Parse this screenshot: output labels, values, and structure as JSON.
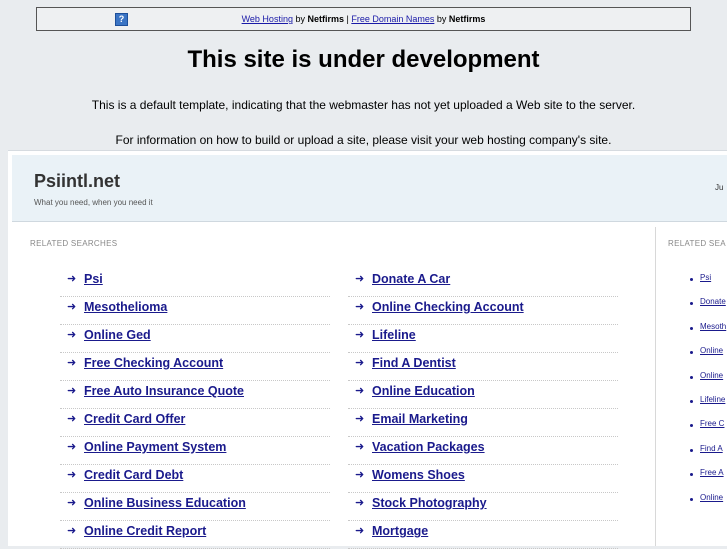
{
  "banner": {
    "link1": "Web Hosting",
    "by1": " by ",
    "brand1": "Netfirms",
    "sep": " | ",
    "link2": "Free Domain Names",
    "by2": " by ",
    "brand2": "Netfirms"
  },
  "heading": "This site is under development",
  "intro1": "This is a default template, indicating that the webmaster has not yet uploaded a Web site to the server.",
  "intro2": "For information on how to build or upload a site, please visit your web hosting company's site.",
  "site": {
    "title": "Psiintl.net",
    "tagline": "What you need, when you need it",
    "header_right": "Ju"
  },
  "related": {
    "label": "RELATED SEARCHES",
    "label_right": "RELATED SEA",
    "col1": [
      "Psi",
      "Mesothelioma",
      "Online Ged",
      "Free Checking Account",
      "Free Auto Insurance Quote",
      "Credit Card Offer",
      "Online Payment System",
      "Credit Card Debt",
      "Online Business Education",
      "Online Credit Report"
    ],
    "col2": [
      "Donate A Car",
      "Online Checking Account",
      "Lifeline",
      "Find A Dentist",
      "Online Education",
      "Email Marketing",
      "Vacation Packages",
      "Womens Shoes",
      "Stock Photography",
      "Mortgage"
    ],
    "right": [
      "Psi",
      "Donate",
      "Mesoth",
      "Online",
      "Online",
      "Lifeline",
      "Free C",
      "Find A",
      "Free A",
      "Online"
    ]
  }
}
